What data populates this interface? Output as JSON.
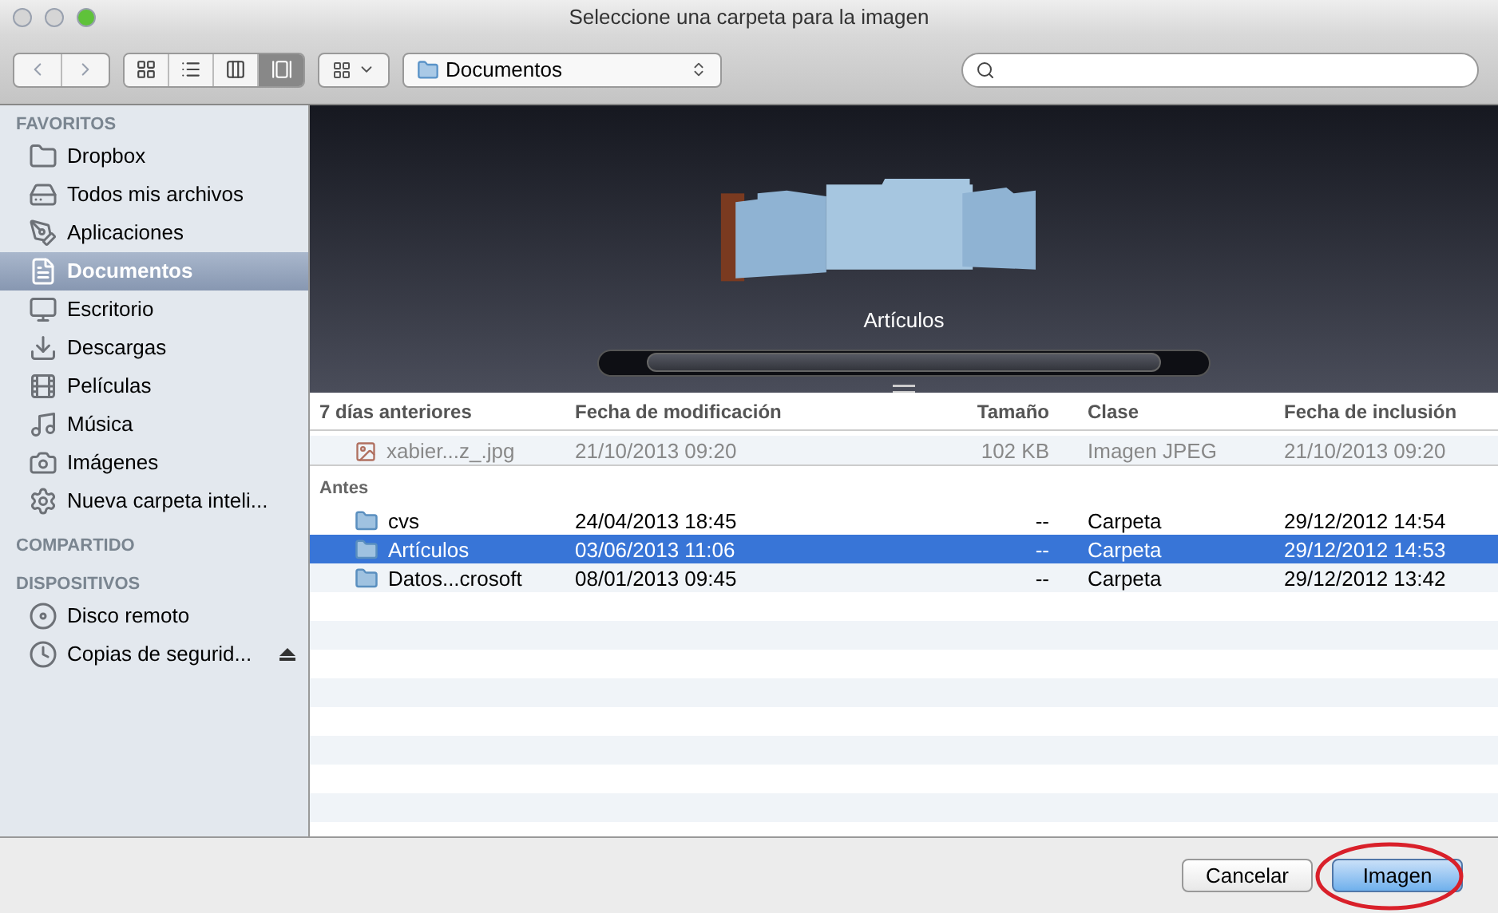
{
  "window": {
    "title": "Seleccione una carpeta para la imagen"
  },
  "toolbar": {
    "views": [
      {
        "kind": "icons",
        "selected": false
      },
      {
        "kind": "list",
        "selected": false
      },
      {
        "kind": "columns",
        "selected": false
      },
      {
        "kind": "coverflow",
        "selected": true
      }
    ],
    "location": "Documentos"
  },
  "sidebar": {
    "sections": [
      {
        "title": "FAVORITOS",
        "items": [
          {
            "label": "Dropbox",
            "kind": "folder",
            "selected": false
          },
          {
            "label": "Todos mis archivos",
            "kind": "files",
            "selected": false
          },
          {
            "label": "Aplicaciones",
            "kind": "apps",
            "selected": false
          },
          {
            "label": "Documentos",
            "kind": "docs",
            "selected": true
          },
          {
            "label": "Escritorio",
            "kind": "desktop",
            "selected": false
          },
          {
            "label": "Descargas",
            "kind": "download",
            "selected": false
          },
          {
            "label": "Películas",
            "kind": "film",
            "selected": false
          },
          {
            "label": "Música",
            "kind": "music",
            "selected": false
          },
          {
            "label": "Imágenes",
            "kind": "camera",
            "selected": false
          },
          {
            "label": "Nueva carpeta inteli...",
            "kind": "gear",
            "selected": false
          }
        ]
      },
      {
        "title": "COMPARTIDO"
      },
      {
        "title": "DISPOSITIVOS",
        "items": [
          {
            "label": "Disco remoto",
            "kind": "disc",
            "selected": false,
            "eject": false
          },
          {
            "label": "Copias de segurid...",
            "kind": "backup",
            "selected": false,
            "eject": true
          }
        ]
      }
    ]
  },
  "coverflow": {
    "caption": "Artículos"
  },
  "table": {
    "columns": [
      "7 días anteriores",
      "Fecha de modificación",
      "Tamaño",
      "Clase",
      "Fecha de inclusión"
    ],
    "groups": [
      {
        "rows": [
          {
            "kind": "image",
            "name": "xabier...z_.jpg",
            "modified": "21/10/2013 09:20",
            "size": "102 KB",
            "class": "Imagen JPEG",
            "added": "21/10/2013 09:20",
            "selected": false,
            "disabled": true
          }
        ]
      },
      {
        "title": "Antes",
        "rows": [
          {
            "kind": "folder",
            "name": "cvs",
            "modified": "24/04/2013 18:45",
            "size": "--",
            "class": "Carpeta",
            "added": "29/12/2012 14:54",
            "selected": false,
            "disabled": false
          },
          {
            "kind": "folder",
            "name": "Artículos",
            "modified": "03/06/2013 11:06",
            "size": "--",
            "class": "Carpeta",
            "added": "29/12/2012 14:53",
            "selected": true,
            "disabled": false
          },
          {
            "kind": "folder",
            "name": "Datos...crosoft",
            "modified": "08/01/2013 09:45",
            "size": "--",
            "class": "Carpeta",
            "added": "29/12/2012 13:42",
            "selected": false,
            "disabled": false
          }
        ]
      }
    ]
  },
  "buttons": [
    {
      "label": "Cancelar",
      "default": false
    },
    {
      "label": "Imagen",
      "default": true,
      "highlighted": true
    }
  ]
}
